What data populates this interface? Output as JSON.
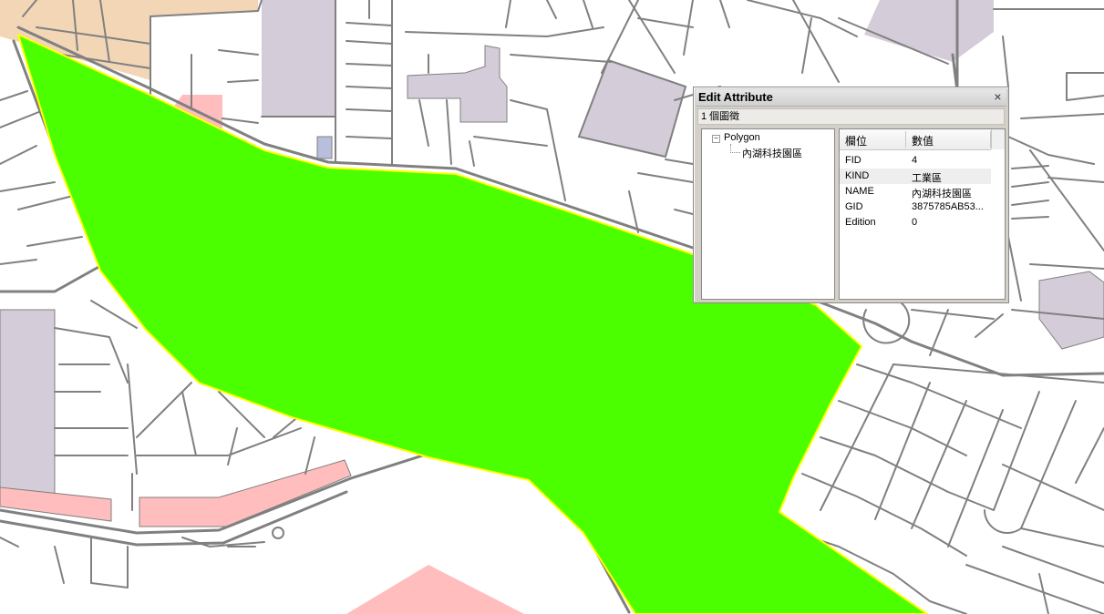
{
  "map": {
    "colors": {
      "background": "#ffffff",
      "road": "#808080",
      "highlight_fill": "#4cff00",
      "highlight_outline": "#ffff00",
      "building": "#d4ccd8",
      "commercial": "#ffbdbd",
      "residential": "#f2d6b6",
      "small_block": "#b8bedc"
    },
    "selected_feature": "內湖科技園區"
  },
  "dialog": {
    "title": "Edit Attribute",
    "close_glyph": "×",
    "feature_count": "1 個圖徵",
    "tree": {
      "toggle_glyph": "−",
      "root": "Polygon",
      "child": "內湖科技園區"
    },
    "grid": {
      "col_field": "欄位",
      "col_value": "數值",
      "rows": [
        {
          "field": "FID",
          "value": "4"
        },
        {
          "field": "KIND",
          "value": "工業區"
        },
        {
          "field": "NAME",
          "value": "內湖科技園區"
        },
        {
          "field": "GID",
          "value": "3875785AB53..."
        },
        {
          "field": "Edition",
          "value": "0"
        }
      ]
    }
  }
}
